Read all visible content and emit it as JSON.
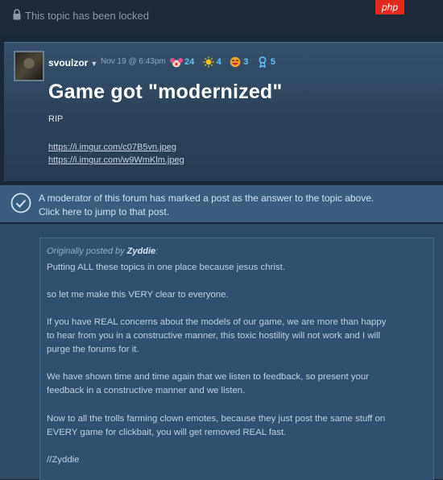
{
  "locked": {
    "text": "This topic has been locked",
    "badge": "php"
  },
  "post": {
    "author": "svoulzor",
    "author_menu_caret": "▼",
    "date": "Nov 19 @ 6:43pm",
    "awards": [
      {
        "icon": "clown-award-icon",
        "count": "24"
      },
      {
        "icon": "sun-award-icon",
        "count": "4"
      },
      {
        "icon": "laughing-face-award-icon",
        "count": "3"
      },
      {
        "icon": "ribbon-award-icon",
        "count": "5"
      }
    ],
    "title": "Game got \"modernized\"",
    "body": "RIP",
    "links": [
      "https://i.imgur.com/c07B5vn.jpeg",
      "https://i.imgur.com/w9WmKlm.jpeg"
    ]
  },
  "answer_notice": {
    "line1": "A moderator of this forum has marked a post as the answer to the topic above.",
    "line2": "Click here to jump to that post."
  },
  "quote": {
    "prefix": "Originally posted by ",
    "author": "Zyddie",
    "suffix": ":",
    "lines": [
      "Putting ALL these topics in one place because jesus christ.",
      "so let me make this VERY clear to everyone.",
      "If you have REAL concerns about the models of our game, we are more than happy",
      "to hear from you in a constructive manner, this toxic hostility will not work and I will",
      "purge the forums for it.",
      "We have shown time and time again that we listen to feedback, so present your",
      "feedback in a constructive manner and we listen.",
      "Now to all the trolls farming clown emotes, because they just post the same stuff on",
      "EVERY game for clickbait, you will get removed REAL fast.",
      "//Zyddie"
    ]
  },
  "colors": {
    "page_bg": "#1b2838",
    "accent_blue": "#66c0f4",
    "answer_bg": "#3a5d7e",
    "php_red": "#e12b1f"
  }
}
